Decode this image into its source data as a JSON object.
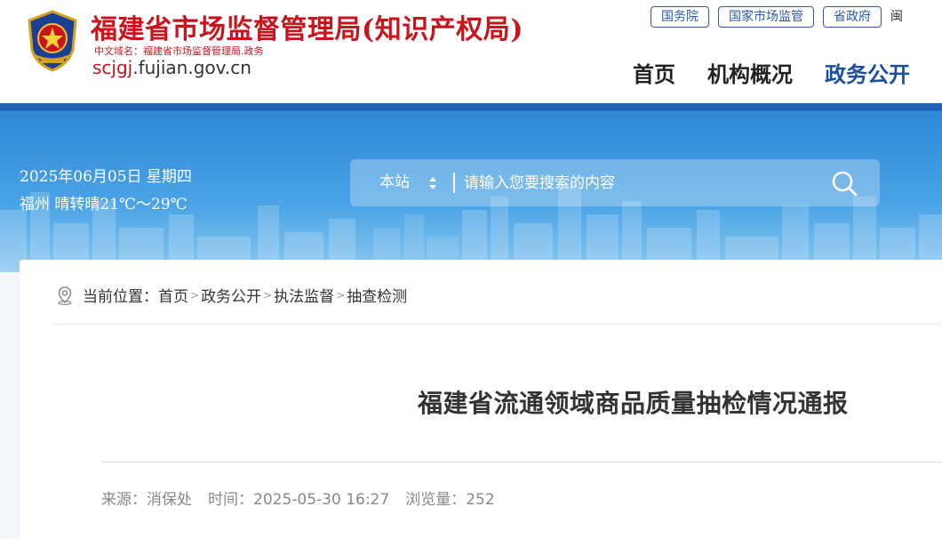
{
  "header": {
    "site_title": "福建省市场监督管理局(知识产权局)",
    "cn_domain": "中文域名：福建省市场监督管理局.政务",
    "domain_highlight": "scjgj",
    "domain_rest": ".fujian.gov.cn",
    "top_links": [
      "国务院",
      "国家市场监管",
      "省政府"
    ],
    "top_link_extra": "闽",
    "nav": [
      "首页",
      "机构概况",
      "政务公开"
    ],
    "active_nav": "政务公开"
  },
  "banner": {
    "date": "2025年06月05日 星期四",
    "weather": "福州 晴转晴21℃～29℃",
    "search": {
      "scope": "本站",
      "placeholder": "请输入您要搜索的内容"
    }
  },
  "breadcrumb": {
    "label": "当前位置：",
    "items": [
      "首页",
      "政务公开",
      "执法监督",
      "抽查检测"
    ],
    "separator": ">"
  },
  "article": {
    "title": "福建省流通领域商品质量抽检情况通报",
    "source": "来源：消保处",
    "time": "时间：2025-05-30 16:27",
    "views": "浏览量：252"
  },
  "colors": {
    "brand_red": "#c8151d",
    "brand_blue": "#1a4f9c",
    "banner_blue": "#2f87d6"
  }
}
